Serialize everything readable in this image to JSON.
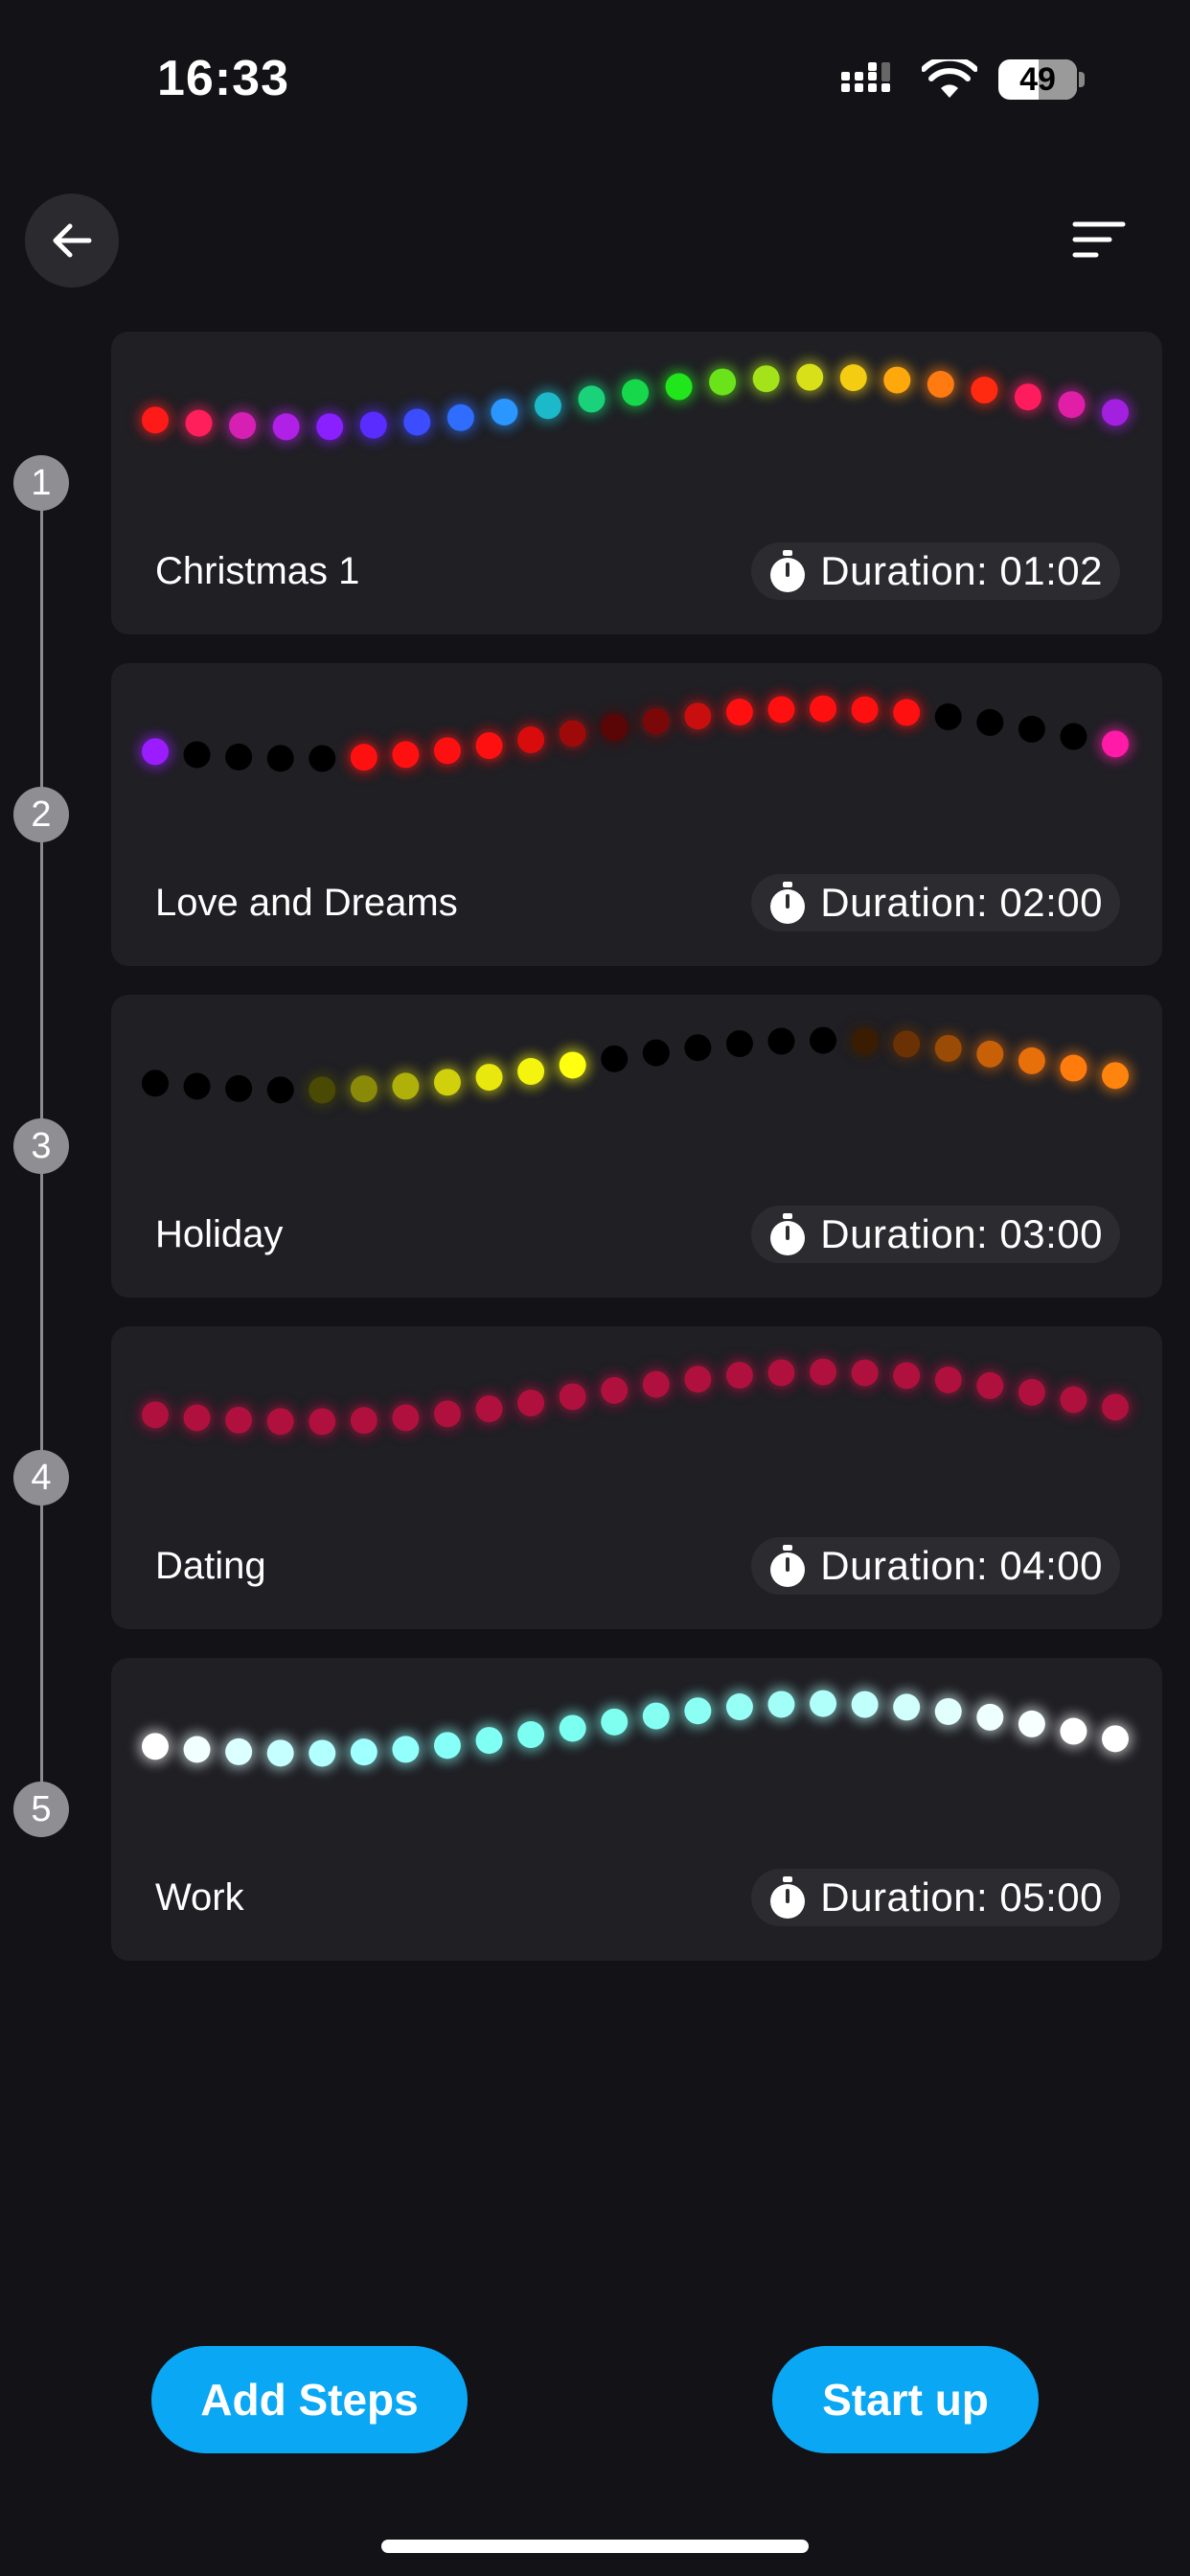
{
  "status_bar": {
    "time": "16:33",
    "battery": "49"
  },
  "header": {
    "back_icon": "arrow-left-icon",
    "sort_icon": "sort-lines-icon"
  },
  "steps": [
    {
      "number": "1",
      "name": "Christmas 1",
      "duration_label": "Duration: 01:02",
      "lights": [
        "#ff1a1a",
        "#ff1f5b",
        "#d620b4",
        "#b020e6",
        "#8a1fff",
        "#5a2cff",
        "#3c4cff",
        "#2f6dff",
        "#2a96ff",
        "#1bb9c9",
        "#19d27a",
        "#16d84a",
        "#22e61c",
        "#6be31a",
        "#a4e21a",
        "#d8e01a",
        "#f4cc12",
        "#ffa80c",
        "#ff7a10",
        "#ff2a10",
        "#ff1c5e",
        "#e11ea6",
        "#a420e0"
      ]
    },
    {
      "number": "2",
      "name": "Love and Dreams",
      "duration_label": "Duration: 02:00",
      "lights": [
        "#9a1cff",
        "#000000",
        "#000000",
        "#000000",
        "#000000",
        "#ff1010",
        "#ff1010",
        "#ff1010",
        "#ff1010",
        "#d80c0c",
        "#9e0a0a",
        "#5a0606",
        "#7a0808",
        "#c80e0e",
        "#ff1010",
        "#ff1010",
        "#ff1010",
        "#ff1010",
        "#ff1010",
        "#000000",
        "#000000",
        "#000000",
        "#000000",
        "#ff1aa8"
      ]
    },
    {
      "number": "3",
      "name": "Holiday",
      "duration_label": "Duration: 03:00",
      "lights": [
        "#000000",
        "#000000",
        "#000000",
        "#000000",
        "#4a4a04",
        "#8a8a08",
        "#b0b00a",
        "#d0d00c",
        "#e8e80e",
        "#f4f40e",
        "#ffff10",
        "#000000",
        "#000000",
        "#000000",
        "#000000",
        "#000000",
        "#000000",
        "#3a1c02",
        "#6a3204",
        "#9a4c06",
        "#c86008",
        "#e8700a",
        "#ff7c0c",
        "#ff840e"
      ]
    },
    {
      "number": "4",
      "name": "Dating",
      "duration_label": "Duration: 04:00",
      "lights": [
        "#b0103e",
        "#b0103e",
        "#b0103e",
        "#b0103e",
        "#b0103e",
        "#b0103e",
        "#b0103e",
        "#b0103e",
        "#b0103e",
        "#b0103e",
        "#b0103e",
        "#b0103e",
        "#b0103e",
        "#b0103e",
        "#b0103e",
        "#b0103e",
        "#b0103e",
        "#b0103e",
        "#b0103e",
        "#b0103e",
        "#b0103e",
        "#b0103e",
        "#b0103e",
        "#b0103e"
      ]
    },
    {
      "number": "5",
      "name": "Work",
      "duration_label": "Duration: 05:00",
      "lights": [
        "#ffffff",
        "#f2ffff",
        "#dcffff",
        "#c6ffff",
        "#b2ffff",
        "#a0ffff",
        "#92fffc",
        "#86fff8",
        "#80fff4",
        "#7cfff2",
        "#7afff0",
        "#7efff0",
        "#84fff2",
        "#8cfff4",
        "#96fff6",
        "#a2fff8",
        "#b0fffa",
        "#c0fffb",
        "#d0fffc",
        "#e0fffd",
        "#eefffe",
        "#f8ffff",
        "#ffffff",
        "#ffffff"
      ]
    }
  ],
  "actions": {
    "add_steps": "Add Steps",
    "start_up": "Start up"
  },
  "colors": {
    "accent": "#0aa7f4",
    "background": "#121217",
    "card": "#1f1f24"
  }
}
